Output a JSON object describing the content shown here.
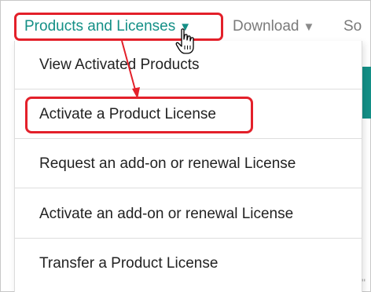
{
  "topnav": {
    "active_label": "Products and Licenses",
    "download_label": "Download",
    "partial_label": "So"
  },
  "dropdown": {
    "items": [
      {
        "label": "View Activated Products"
      },
      {
        "label": "Activate a Product License"
      },
      {
        "label": "Request an add-on or renewal License"
      },
      {
        "label": "Activate an add-on or renewal License"
      },
      {
        "label": "Transfer a Product License"
      }
    ]
  },
  "edge_mark": "\""
}
